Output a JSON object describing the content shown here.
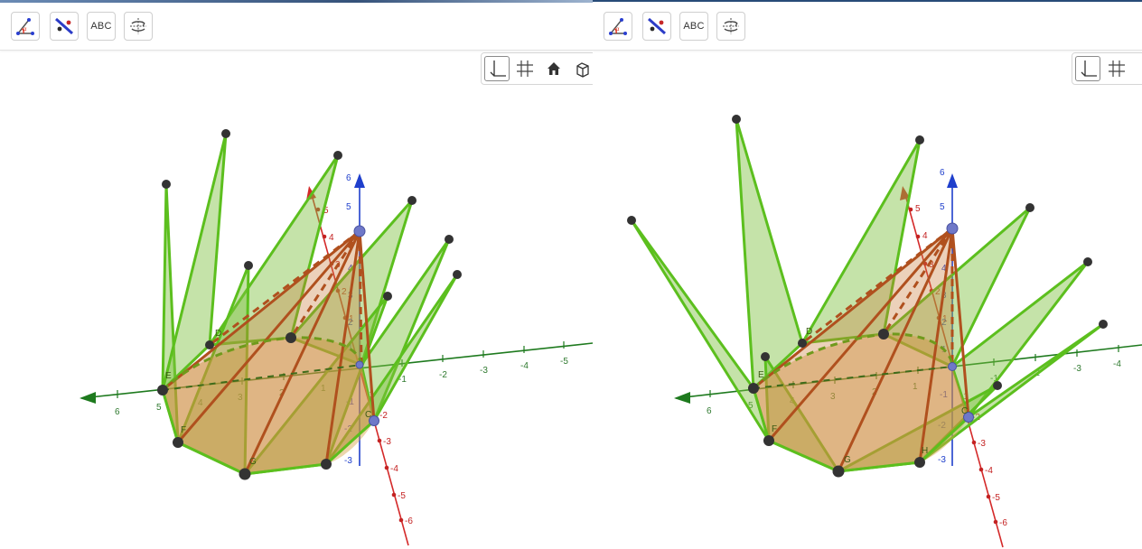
{
  "toolbar": {
    "buttons": [
      {
        "name": "angle-tool",
        "label": ""
      },
      {
        "name": "reflect-line-tool",
        "label": ""
      },
      {
        "name": "text-tool",
        "label": "ABC"
      },
      {
        "name": "rotate-view-tool",
        "label": ""
      }
    ]
  },
  "view_controls": [
    "axes-toggle",
    "grid-toggle",
    "home-view",
    "view-direction"
  ],
  "axes": {
    "x_ticks": [
      "6",
      "5",
      "4",
      "3",
      "2",
      "1",
      "-1",
      "-2",
      "-3",
      "-4",
      "-5"
    ],
    "y_ticks": [
      "5",
      "4",
      "3",
      "2",
      "1",
      "-1",
      "-2",
      "-3",
      "-4",
      "-5",
      "-6"
    ],
    "z_ticks": [
      "6",
      "5",
      "4",
      "3",
      "2",
      "1",
      "-1",
      "-2",
      "-3"
    ]
  },
  "points": {
    "left": [
      "E",
      "D",
      "F",
      "G",
      "C"
    ],
    "right": [
      "E",
      "D",
      "F",
      "G",
      "H",
      "C"
    ]
  },
  "colors": {
    "x_axis": "#1e7a1e",
    "y_axis": "#d42a2a",
    "z_axis": "#1f3fcc",
    "face_green": "#7fc241",
    "edge_green": "#5cbf1e",
    "cone_fill": "#d4a14a",
    "cone_edge": "#b0501e",
    "point_dark": "#333333",
    "point_blue": "#6f78c8"
  }
}
